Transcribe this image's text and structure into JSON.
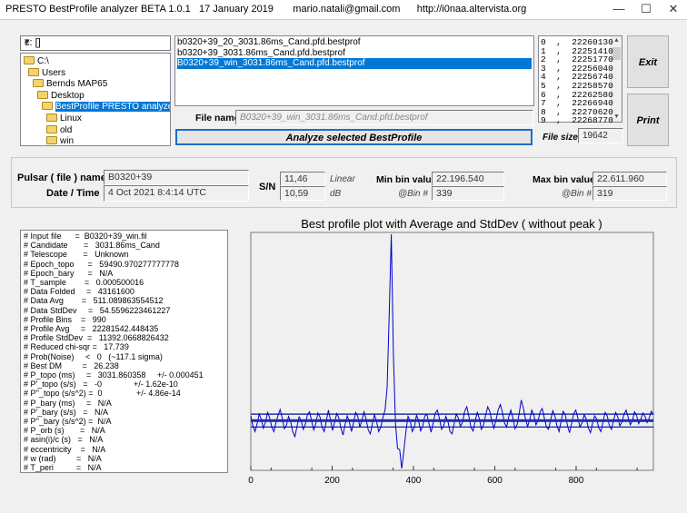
{
  "window": {
    "title": "PRESTO BestProfile analyzer BETA 1.0.1   17 January 2019       mario.natali@gmail.com      http://i0naa.altervista.org",
    "min_glyph": "—",
    "max_glyph": "☐",
    "close_glyph": "✕"
  },
  "drive": {
    "label": "c: []",
    "arrow": "▾"
  },
  "tree": [
    {
      "label": "C:\\",
      "indent": 0,
      "selected": false
    },
    {
      "label": "Users",
      "indent": 1,
      "selected": false
    },
    {
      "label": "Bernds MAP65",
      "indent": 2,
      "selected": false
    },
    {
      "label": "Desktop",
      "indent": 3,
      "selected": false
    },
    {
      "label": "BestProfile PRESTO analyzer 1.0.1.e",
      "indent": 4,
      "selected": true
    },
    {
      "label": "Linux",
      "indent": 5,
      "selected": false
    },
    {
      "label": "old",
      "indent": 5,
      "selected": false
    },
    {
      "label": "win",
      "indent": 5,
      "selected": false
    }
  ],
  "files": [
    {
      "label": "b0320+39_20_3031.86ms_Cand.pfd.bestprof",
      "selected": false
    },
    {
      "label": "b0320+39_3031.86ms_Cand.pfd.bestprof",
      "selected": false
    },
    {
      "label": "B0320+39_win_3031.86ms_Cand.pfd.bestprof",
      "selected": true
    }
  ],
  "numbers": [
    "0  ,  22260130",
    "1  ,  22251410",
    "2  ,  22251770",
    "3  ,  22256040",
    "4  ,  22256740",
    "5  ,  22258570",
    "6  ,  22262580",
    "7  ,  22266940",
    "8  ,  22270620",
    "9  ,  22268770"
  ],
  "buttons": {
    "exit": "Exit",
    "print": "Print",
    "analyze": "Analyze selected BestProfile"
  },
  "file_name": {
    "label": "File name",
    "value": "B0320+39_win_3031.86ms_Cand.pfd.bestprof"
  },
  "file_size": {
    "label": "File size",
    "value": "19642"
  },
  "summary": {
    "pulsar_label": "Pulsar ( file ) name",
    "pulsar_value": "B0320+39",
    "date_label": "Date / Time",
    "date_value": "4 Oct 2021    8:4:14   UTC",
    "sn_label": "S/N",
    "sn_linear": "11,46",
    "sn_linear_unit": "Linear",
    "sn_db": "10,59",
    "sn_db_unit": "dB",
    "min_label": "Min bin value",
    "min_value": "22.196.540",
    "min_bin_label": "@Bin #",
    "min_bin_value": "339",
    "max_label": "Max bin value",
    "max_value": "22.611.960",
    "max_bin_label": "@Bin #",
    "max_bin_value": "319"
  },
  "info_lines": [
    "# Input file      =  B0320+39_win.fil",
    "# Candidate       =   3031.86ms_Cand",
    "# Telescope       =   Unknown",
    "# Epoch_topo      =   59490.970277777778",
    "# Epoch_bary      =   N/A",
    "# T_sample        =   0.000500016",
    "# Data Folded     =   43161600",
    "# Data Avg        =   511.089863554512",
    "# Data StdDev     =   54.5596223461227",
    "# Profile Bins    =   990",
    "# Profile Avg     =   22281542.448435",
    "# Profile StdDev  =   11392.0668826432",
    "# Reduced chi-sqr =   17.739",
    "# Prob(Noise)     <   0   (~117.1 sigma)",
    "# Best DM         =   26.238",
    "# P_topo (ms)     =   3031.860358     +/- 0.000451",
    "# P'_topo (s/s)   =   -0              +/- 1.62e-10",
    "# P''_topo (s/s^2) =  0               +/- 4.86e-14",
    "# P_bary (ms)     =   N/A",
    "# P'_bary (s/s)   =   N/A",
    "# P''_bary (s/s^2) =  N/A",
    "# P_orb (s)       =   N/A",
    "# asin(i)/c (s)   =   N/A",
    "# eccentricity    =   N/A",
    "# w (rad)         =   N/A",
    "# T_peri          =   N/A"
  ],
  "chart_data": {
    "type": "line",
    "title": "Best profile plot with  Average and StdDev ( without peak )",
    "xlabel": "",
    "ylabel": "",
    "xlim": [
      0,
      990
    ],
    "ylim": [
      22196540,
      22611960
    ],
    "x_ticks": [
      0,
      200,
      400,
      600,
      800
    ],
    "peak": {
      "bin": 319,
      "value": 22611960
    },
    "min": {
      "bin": 339,
      "value": 22196540
    },
    "average": 22281542.448435,
    "upper_band": 22292934.5,
    "lower_band": 22270150.4,
    "series": [
      {
        "color": "#0000cc",
        "values": [
          22290000,
          22272000,
          22262000,
          22276000,
          22293000,
          22284000,
          22268000,
          22279000,
          22296000,
          22286000,
          22270000,
          22262000,
          22278000,
          22291000,
          22301000,
          22286000,
          22267000,
          22273000,
          22289000,
          22280000,
          22262000,
          22253000,
          22271000,
          22288000,
          22282000,
          22266000,
          22275000,
          22292000,
          22297000,
          22281000,
          22265000,
          22276000,
          22295000,
          22288000,
          22270000,
          22262000,
          22281000,
          22300000,
          22283000,
          22264000,
          22279000,
          22294000,
          22286000,
          22268000,
          22256000,
          22275000,
          22290000,
          22279000,
          22262000,
          22278000,
          22296000,
          22289000,
          22270000,
          22282000,
          22297000,
          22284000,
          22265000,
          22258000,
          22276000,
          22292000,
          22280000,
          22262000,
          22270000,
          22287000,
          22300000,
          22340000,
          22470000,
          22611960,
          22400000,
          22276000,
          22232000,
          22230000,
          22196540,
          22228000,
          22262000,
          22289000,
          22281000,
          22262000,
          22270000,
          22291000,
          22282000,
          22263000,
          22272000,
          22290000,
          22293000,
          22276000,
          22261000,
          22277000,
          22295000,
          22300000,
          22284000,
          22266000,
          22272000,
          22289000,
          22280000,
          22262000,
          22258000,
          22276000,
          22293000,
          22286000,
          22271000,
          22279000,
          22298000,
          22306000,
          22289000,
          22269000,
          22263000,
          22281000,
          22296000,
          22285000,
          22266000,
          22274000,
          22291000,
          22306000,
          22298000,
          22280000,
          22268000,
          22284000,
          22301000,
          22310000,
          22296000,
          22277000,
          22270000,
          22288000,
          22300000,
          22286000,
          22267000,
          22274000,
          22294000,
          22318000,
          22304000,
          22284000,
          22271000,
          22283000,
          22300000,
          22291000,
          22274000,
          22281000,
          22297000,
          22303000,
          22286000,
          22270000,
          22266000,
          22282000,
          22299000,
          22290000,
          22272000,
          22262000,
          22281000,
          22298000,
          22291000,
          22273000,
          22260000,
          22276000,
          22294000,
          22300000,
          22286000,
          22270000,
          22278000,
          22292000,
          22284000,
          22268000,
          22260000,
          22277000,
          22290000,
          22284000,
          22268000,
          22262000,
          22279000,
          22296000,
          22290000,
          22273000,
          22266000,
          22282000,
          22296000,
          22288000,
          22272000,
          22279000,
          22293000,
          22300000,
          22287000,
          22274000,
          22281000,
          22297000,
          22291000,
          22276000,
          22284000,
          22295000,
          22289000,
          22278000,
          22286000,
          22298000,
          22292000
        ]
      }
    ]
  }
}
